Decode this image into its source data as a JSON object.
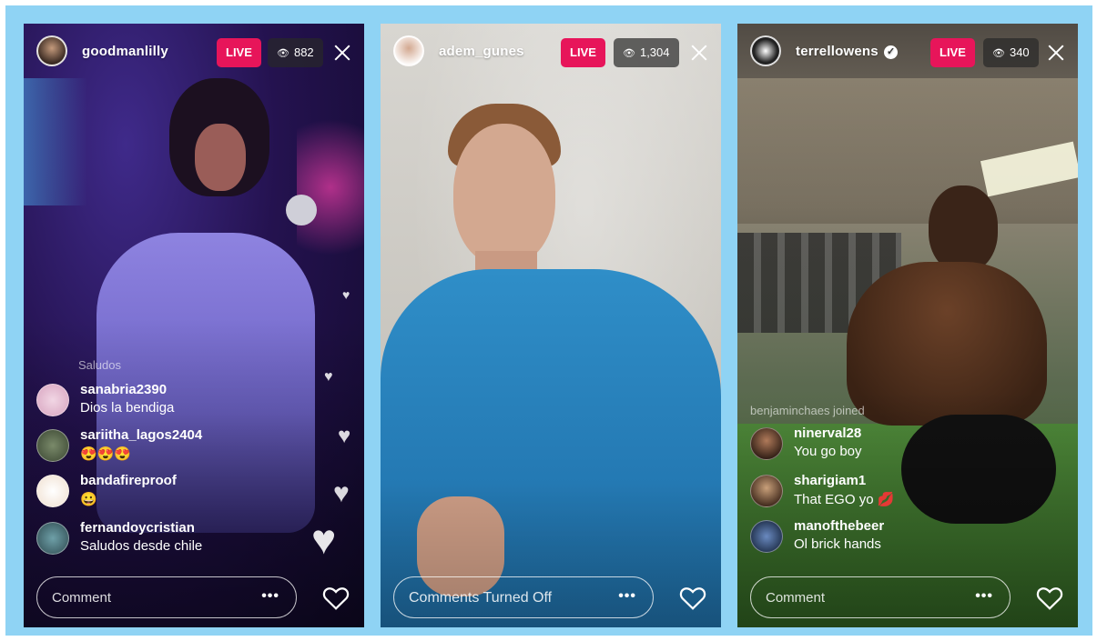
{
  "streams": [
    {
      "username": "goodmanlilly",
      "live_label": "LIVE",
      "viewer_count": "882",
      "system_text": "Saludos",
      "comments": [
        {
          "user": "sanabria2390",
          "text": "Dios la bendiga"
        },
        {
          "user": "sariitha_lagos2404",
          "text": "😍😍😍"
        },
        {
          "user": "bandafireproof",
          "text": "😀"
        },
        {
          "user": "fernandoycristian",
          "text": "Saludos desde chile"
        }
      ],
      "comment_placeholder": "Comment",
      "more_label": "•••"
    },
    {
      "username": "adem_gunes",
      "live_label": "LIVE",
      "viewer_count": "1,304",
      "comment_placeholder": "Comments Turned Off",
      "more_label": "•••"
    },
    {
      "username": "terrellowens",
      "verified": true,
      "live_label": "LIVE",
      "viewer_count": "340",
      "system_text": "benjaminchaes joined",
      "comments": [
        {
          "user": "ninerval28",
          "text": "You go boy"
        },
        {
          "user": "sharigiam1",
          "text": "That EGO yo 💋"
        },
        {
          "user": "manofthebeer",
          "text": "Ol brick hands"
        }
      ],
      "comment_placeholder": "Comment",
      "more_label": "•••"
    }
  ],
  "colors": {
    "frame": "#8fd3f4",
    "live": "#e7155a"
  }
}
